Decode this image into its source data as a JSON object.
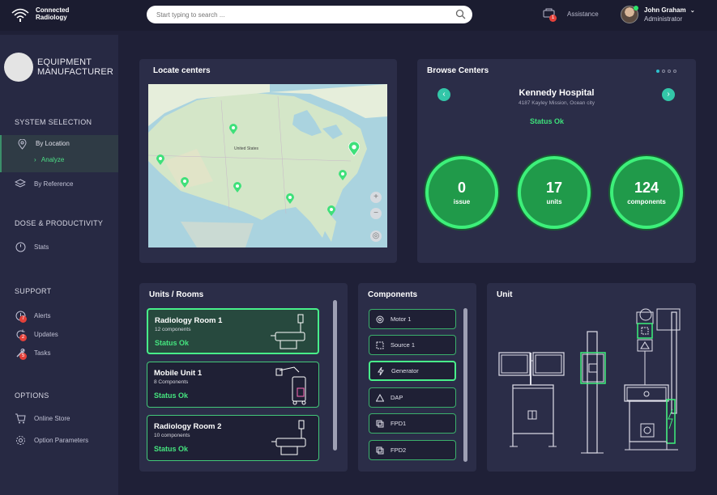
{
  "app": {
    "name_line1": "Connected",
    "name_line2": "Radiology"
  },
  "search": {
    "placeholder": "Start typing to search ..."
  },
  "assistance": {
    "label": "Assistance",
    "badge": "1"
  },
  "user": {
    "name": "John Graham",
    "role": "Administrator"
  },
  "sidebar": {
    "manufacturer_line1": "EQUIPMENT",
    "manufacturer_line2": "MANUFACTURER",
    "system_selection": "SYSTEM SELECTION",
    "by_location": "By Location",
    "analyze": "Analyze",
    "by_reference": "By Reference",
    "dose_productivity": "DOSE & PRODUCTIVITY",
    "stats": "Stats",
    "support": "SUPPORT",
    "alerts": "Alerts",
    "alerts_badge": "7",
    "updates": "Updates",
    "updates_badge": "2",
    "tasks": "Tasks",
    "tasks_badge": "5",
    "options": "OPTIONS",
    "online_store": "Online Store",
    "option_parameters": "Option Parameters"
  },
  "locate": {
    "title": "Locate centers",
    "map_label": "United States"
  },
  "browse": {
    "title": "Browse Centers",
    "hospital": "Kennedy Hospital",
    "address": "4187 Kayley Mission, Ocean city",
    "status": "Status Ok",
    "stats": [
      {
        "value": "0",
        "label": "issue"
      },
      {
        "value": "17",
        "label": "units"
      },
      {
        "value": "124",
        "label": "components"
      }
    ]
  },
  "units": {
    "title": "Units / Rooms",
    "items": [
      {
        "name": "Radiology Room 1",
        "count": "12 components",
        "status": "Status Ok"
      },
      {
        "name": "Mobile Unit 1",
        "count": "8 Components",
        "status": "Status Ok"
      },
      {
        "name": "Radiology Room 2",
        "count": "10 components",
        "status": "Status Ok"
      }
    ]
  },
  "components": {
    "title": "Components",
    "items": [
      "Motor 1",
      "Source 1",
      "Generator",
      "DAP",
      "FPD1",
      "FPD2"
    ]
  },
  "unit": {
    "title": "Unit"
  },
  "colors": {
    "accent": "#3df07a",
    "background": "#1f2037",
    "card": "#2b2d48",
    "badge": "#e4413a"
  }
}
